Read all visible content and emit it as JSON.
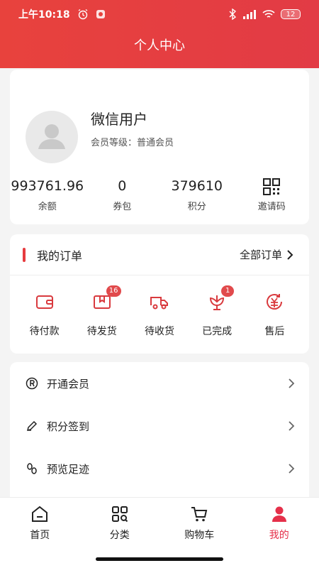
{
  "status_bar": {
    "time": "上午10:18",
    "battery": "12"
  },
  "header": {
    "title": "个人中心"
  },
  "profile": {
    "name": "微信用户",
    "level": "会员等级：普通会员",
    "stats": [
      {
        "value": "993761.96",
        "label": "余额"
      },
      {
        "value": "0",
        "label": "券包"
      },
      {
        "value": "379610",
        "label": "积分"
      },
      {
        "label": "邀请码",
        "icon": "qr-code-icon"
      }
    ]
  },
  "orders": {
    "title": "我的订单",
    "all_label": "全部订单",
    "items": [
      {
        "label": "待付款",
        "icon": "wallet-icon",
        "badge": null
      },
      {
        "label": "待发货",
        "icon": "package-icon",
        "badge": "16"
      },
      {
        "label": "待收货",
        "icon": "truck-icon",
        "badge": null
      },
      {
        "label": "已完成",
        "icon": "flower-icon",
        "badge": "1"
      },
      {
        "label": "售后",
        "icon": "refund-icon",
        "badge": null
      }
    ]
  },
  "menu": [
    {
      "label": "开通会员",
      "icon": "registered-icon"
    },
    {
      "label": "积分签到",
      "icon": "pencil-icon"
    },
    {
      "label": "预览足迹",
      "icon": "footprint-icon"
    }
  ],
  "tabbar": {
    "tabs": [
      {
        "label": "首页",
        "icon": "home-icon",
        "active": false
      },
      {
        "label": "分类",
        "icon": "category-icon",
        "active": false
      },
      {
        "label": "购物车",
        "icon": "cart-icon",
        "active": false
      },
      {
        "label": "我的",
        "icon": "profile-icon",
        "active": true
      }
    ]
  },
  "colors": {
    "brand": "#e63b3f",
    "active_tab": "#e5304a"
  }
}
